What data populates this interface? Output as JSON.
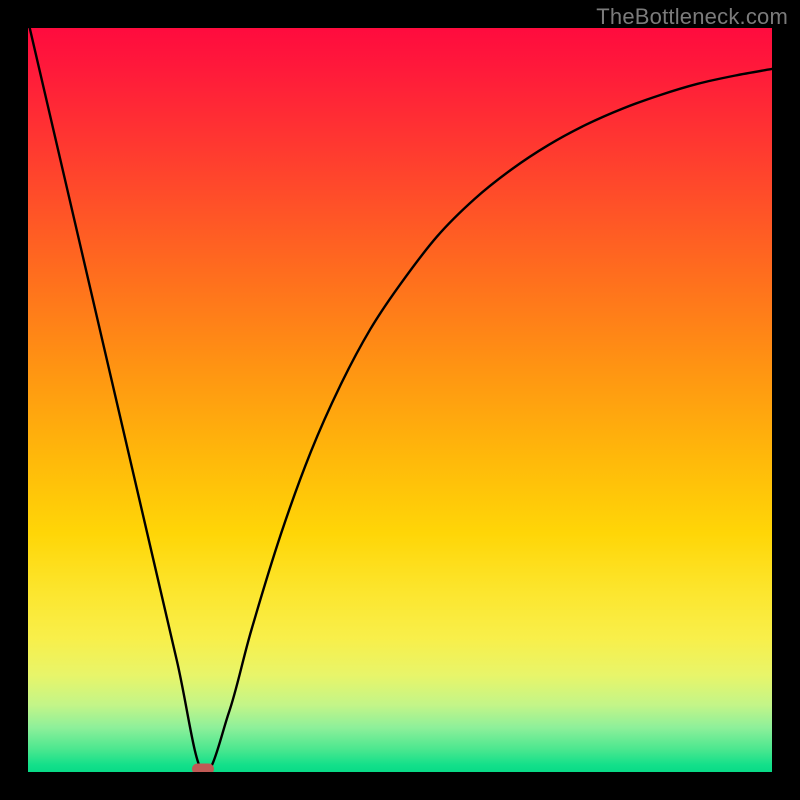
{
  "watermark": "TheBottleneck.com",
  "colors": {
    "frame": "#000000",
    "curve": "#000000",
    "marker": "#c05a55",
    "gradient_top": "#ff0b3e",
    "gradient_bottom": "#08db87"
  },
  "chart_data": {
    "type": "line",
    "title": "",
    "xlabel": "",
    "ylabel": "",
    "xlim": [
      0,
      100
    ],
    "ylim": [
      0,
      100
    ],
    "grid": false,
    "legend": false,
    "series": [
      {
        "name": "bottleneck-curve",
        "x": [
          0,
          5,
          10,
          15,
          20,
          23.5,
          27,
          30,
          34,
          38,
          42,
          46,
          50,
          55,
          60,
          65,
          70,
          75,
          80,
          85,
          90,
          95,
          100
        ],
        "y": [
          101,
          79.5,
          58,
          36.5,
          15,
          0,
          8,
          19,
          32,
          43,
          52,
          59.5,
          65.5,
          72,
          77,
          81,
          84.3,
          87,
          89.2,
          91,
          92.5,
          93.6,
          94.5
        ]
      }
    ],
    "annotations": [
      {
        "name": "minimum-marker",
        "x": 23.5,
        "y": 0
      }
    ],
    "background": "vertical-gradient red→yellow→green (green at bottom)"
  }
}
